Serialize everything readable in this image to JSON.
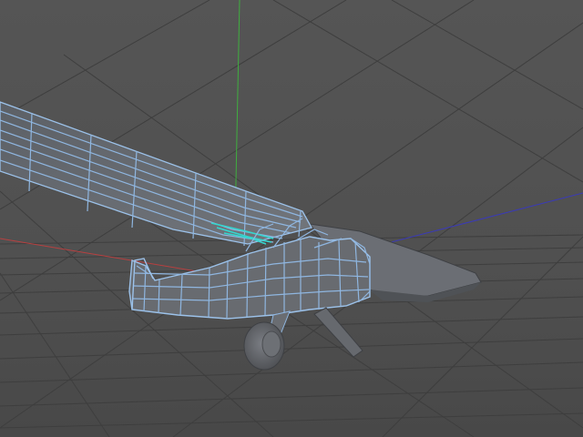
{
  "viewport": {
    "background": "#515151",
    "grid_color": "#3d3d3d",
    "axis_colors": {
      "x": "#c03a3a",
      "y": "#3fae3f",
      "z": "#3535b8"
    }
  },
  "model": {
    "wireframe_color": "#8fb6e0",
    "selection_color": "#35d6cf",
    "surface_color": "#6a6d72",
    "tire_color": "#5f6166"
  }
}
